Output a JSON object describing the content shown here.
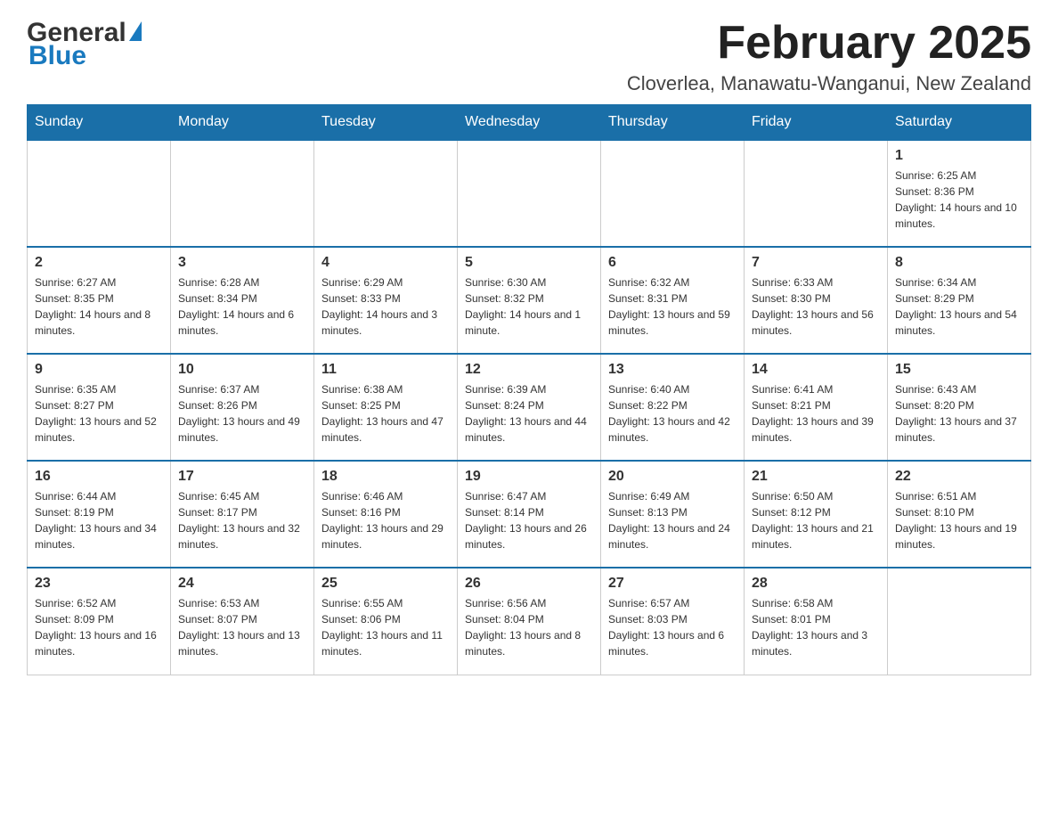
{
  "logo": {
    "text_general": "General",
    "text_blue": "Blue"
  },
  "header": {
    "month_year": "February 2025",
    "location": "Cloverlea, Manawatu-Wanganui, New Zealand"
  },
  "weekdays": [
    "Sunday",
    "Monday",
    "Tuesday",
    "Wednesday",
    "Thursday",
    "Friday",
    "Saturday"
  ],
  "weeks": [
    [
      {
        "day": "",
        "info": ""
      },
      {
        "day": "",
        "info": ""
      },
      {
        "day": "",
        "info": ""
      },
      {
        "day": "",
        "info": ""
      },
      {
        "day": "",
        "info": ""
      },
      {
        "day": "",
        "info": ""
      },
      {
        "day": "1",
        "info": "Sunrise: 6:25 AM\nSunset: 8:36 PM\nDaylight: 14 hours and 10 minutes."
      }
    ],
    [
      {
        "day": "2",
        "info": "Sunrise: 6:27 AM\nSunset: 8:35 PM\nDaylight: 14 hours and 8 minutes."
      },
      {
        "day": "3",
        "info": "Sunrise: 6:28 AM\nSunset: 8:34 PM\nDaylight: 14 hours and 6 minutes."
      },
      {
        "day": "4",
        "info": "Sunrise: 6:29 AM\nSunset: 8:33 PM\nDaylight: 14 hours and 3 minutes."
      },
      {
        "day": "5",
        "info": "Sunrise: 6:30 AM\nSunset: 8:32 PM\nDaylight: 14 hours and 1 minute."
      },
      {
        "day": "6",
        "info": "Sunrise: 6:32 AM\nSunset: 8:31 PM\nDaylight: 13 hours and 59 minutes."
      },
      {
        "day": "7",
        "info": "Sunrise: 6:33 AM\nSunset: 8:30 PM\nDaylight: 13 hours and 56 minutes."
      },
      {
        "day": "8",
        "info": "Sunrise: 6:34 AM\nSunset: 8:29 PM\nDaylight: 13 hours and 54 minutes."
      }
    ],
    [
      {
        "day": "9",
        "info": "Sunrise: 6:35 AM\nSunset: 8:27 PM\nDaylight: 13 hours and 52 minutes."
      },
      {
        "day": "10",
        "info": "Sunrise: 6:37 AM\nSunset: 8:26 PM\nDaylight: 13 hours and 49 minutes."
      },
      {
        "day": "11",
        "info": "Sunrise: 6:38 AM\nSunset: 8:25 PM\nDaylight: 13 hours and 47 minutes."
      },
      {
        "day": "12",
        "info": "Sunrise: 6:39 AM\nSunset: 8:24 PM\nDaylight: 13 hours and 44 minutes."
      },
      {
        "day": "13",
        "info": "Sunrise: 6:40 AM\nSunset: 8:22 PM\nDaylight: 13 hours and 42 minutes."
      },
      {
        "day": "14",
        "info": "Sunrise: 6:41 AM\nSunset: 8:21 PM\nDaylight: 13 hours and 39 minutes."
      },
      {
        "day": "15",
        "info": "Sunrise: 6:43 AM\nSunset: 8:20 PM\nDaylight: 13 hours and 37 minutes."
      }
    ],
    [
      {
        "day": "16",
        "info": "Sunrise: 6:44 AM\nSunset: 8:19 PM\nDaylight: 13 hours and 34 minutes."
      },
      {
        "day": "17",
        "info": "Sunrise: 6:45 AM\nSunset: 8:17 PM\nDaylight: 13 hours and 32 minutes."
      },
      {
        "day": "18",
        "info": "Sunrise: 6:46 AM\nSunset: 8:16 PM\nDaylight: 13 hours and 29 minutes."
      },
      {
        "day": "19",
        "info": "Sunrise: 6:47 AM\nSunset: 8:14 PM\nDaylight: 13 hours and 26 minutes."
      },
      {
        "day": "20",
        "info": "Sunrise: 6:49 AM\nSunset: 8:13 PM\nDaylight: 13 hours and 24 minutes."
      },
      {
        "day": "21",
        "info": "Sunrise: 6:50 AM\nSunset: 8:12 PM\nDaylight: 13 hours and 21 minutes."
      },
      {
        "day": "22",
        "info": "Sunrise: 6:51 AM\nSunset: 8:10 PM\nDaylight: 13 hours and 19 minutes."
      }
    ],
    [
      {
        "day": "23",
        "info": "Sunrise: 6:52 AM\nSunset: 8:09 PM\nDaylight: 13 hours and 16 minutes."
      },
      {
        "day": "24",
        "info": "Sunrise: 6:53 AM\nSunset: 8:07 PM\nDaylight: 13 hours and 13 minutes."
      },
      {
        "day": "25",
        "info": "Sunrise: 6:55 AM\nSunset: 8:06 PM\nDaylight: 13 hours and 11 minutes."
      },
      {
        "day": "26",
        "info": "Sunrise: 6:56 AM\nSunset: 8:04 PM\nDaylight: 13 hours and 8 minutes."
      },
      {
        "day": "27",
        "info": "Sunrise: 6:57 AM\nSunset: 8:03 PM\nDaylight: 13 hours and 6 minutes."
      },
      {
        "day": "28",
        "info": "Sunrise: 6:58 AM\nSunset: 8:01 PM\nDaylight: 13 hours and 3 minutes."
      },
      {
        "day": "",
        "info": ""
      }
    ]
  ]
}
